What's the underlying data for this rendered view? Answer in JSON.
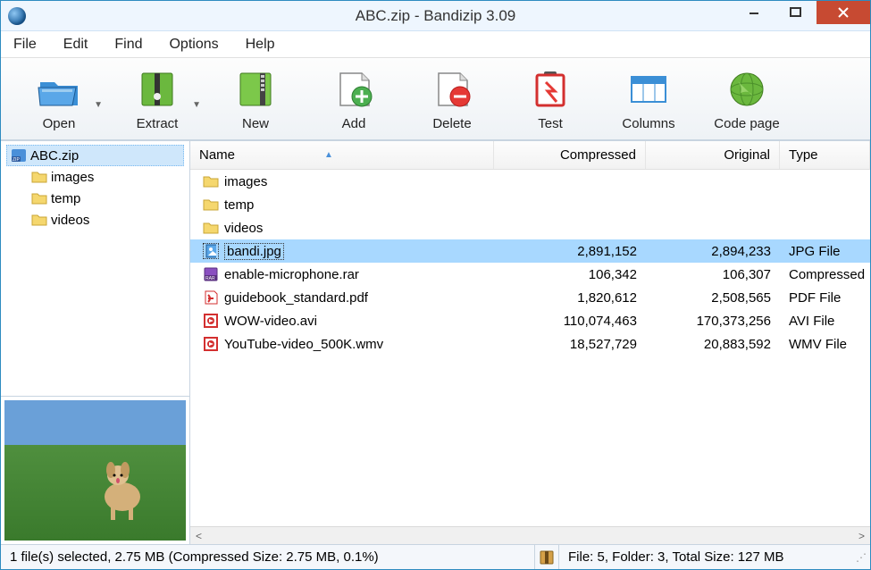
{
  "title": "ABC.zip - Bandizip 3.09",
  "menu": {
    "file": "File",
    "edit": "Edit",
    "find": "Find",
    "options": "Options",
    "help": "Help"
  },
  "toolbar": {
    "open": "Open",
    "extract": "Extract",
    "new": "New",
    "add": "Add",
    "delete": "Delete",
    "test": "Test",
    "columns": "Columns",
    "codepage": "Code page"
  },
  "columns": {
    "name": "Name",
    "compressed": "Compressed",
    "original": "Original",
    "type": "Type"
  },
  "tree": {
    "root": "ABC.zip",
    "children": [
      {
        "label": "images"
      },
      {
        "label": "temp"
      },
      {
        "label": "videos"
      }
    ]
  },
  "files": [
    {
      "icon": "folder",
      "name": "images",
      "compressed": "",
      "original": "",
      "type": "",
      "selected": false
    },
    {
      "icon": "folder",
      "name": "temp",
      "compressed": "",
      "original": "",
      "type": "",
      "selected": false
    },
    {
      "icon": "folder",
      "name": "videos",
      "compressed": "",
      "original": "",
      "type": "",
      "selected": false
    },
    {
      "icon": "jpg",
      "name": "bandi.jpg",
      "compressed": "2,891,152",
      "original": "2,894,233",
      "type": "JPG File",
      "selected": true
    },
    {
      "icon": "rar",
      "name": "enable-microphone.rar",
      "compressed": "106,342",
      "original": "106,307",
      "type": "Compressed",
      "selected": false
    },
    {
      "icon": "pdf",
      "name": "guidebook_standard.pdf",
      "compressed": "1,820,612",
      "original": "2,508,565",
      "type": "PDF File",
      "selected": false
    },
    {
      "icon": "avi",
      "name": "WOW-video.avi",
      "compressed": "110,074,463",
      "original": "170,373,256",
      "type": "AVI File",
      "selected": false
    },
    {
      "icon": "wmv",
      "name": "YouTube-video_500K.wmv",
      "compressed": "18,527,729",
      "original": "20,883,592",
      "type": "WMV File",
      "selected": false
    }
  ],
  "status": {
    "left": "1 file(s) selected, 2.75 MB (Compressed Size: 2.75 MB, 0.1%)",
    "right": "File: 5, Folder: 3, Total Size: 127 MB"
  },
  "scroll": {
    "left": "<",
    "right": ">"
  }
}
